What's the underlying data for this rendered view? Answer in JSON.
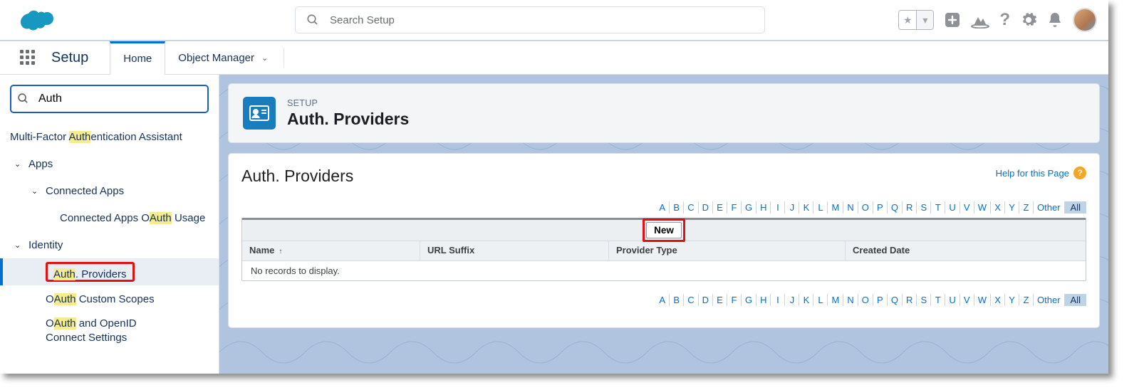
{
  "topbar": {
    "search_placeholder": "Search Setup"
  },
  "navbar": {
    "app_name": "Setup",
    "tab_home": "Home",
    "tab_object_manager": "Object Manager"
  },
  "sidebar": {
    "search_value": "Auth",
    "mfa_prefix": "Multi-Factor ",
    "mfa_hl": "Auth",
    "mfa_suffix": "entication Assistant",
    "apps": "Apps",
    "connected_apps": "Connected Apps",
    "cao_prefix": "Connected Apps O",
    "cao_hl": "Auth",
    "cao_suffix": " Usage",
    "identity": "Identity",
    "auth_providers_hl": "Auth",
    "auth_providers_suffix": ". Providers",
    "ocs_prefix": "O",
    "ocs_hl": "Auth",
    "ocs_suffix": " Custom Scopes",
    "ooc_prefix": "O",
    "ooc_hl": "Auth",
    "ooc_suffix": " and OpenID Connect Settings"
  },
  "page_header": {
    "eyebrow": "SETUP",
    "title": "Auth. Providers"
  },
  "content": {
    "title": "Auth. Providers",
    "help_label": "Help for this Page",
    "new_button": "New",
    "empty_message": "No records to display.",
    "columns": {
      "name": "Name",
      "url_suffix": "URL Suffix",
      "provider_type": "Provider Type",
      "created_date": "Created Date"
    },
    "alpha": [
      "A",
      "B",
      "C",
      "D",
      "E",
      "F",
      "G",
      "H",
      "I",
      "J",
      "K",
      "L",
      "M",
      "N",
      "O",
      "P",
      "Q",
      "R",
      "S",
      "T",
      "U",
      "V",
      "W",
      "X",
      "Y",
      "Z"
    ],
    "other_label": "Other",
    "all_label": "All"
  }
}
